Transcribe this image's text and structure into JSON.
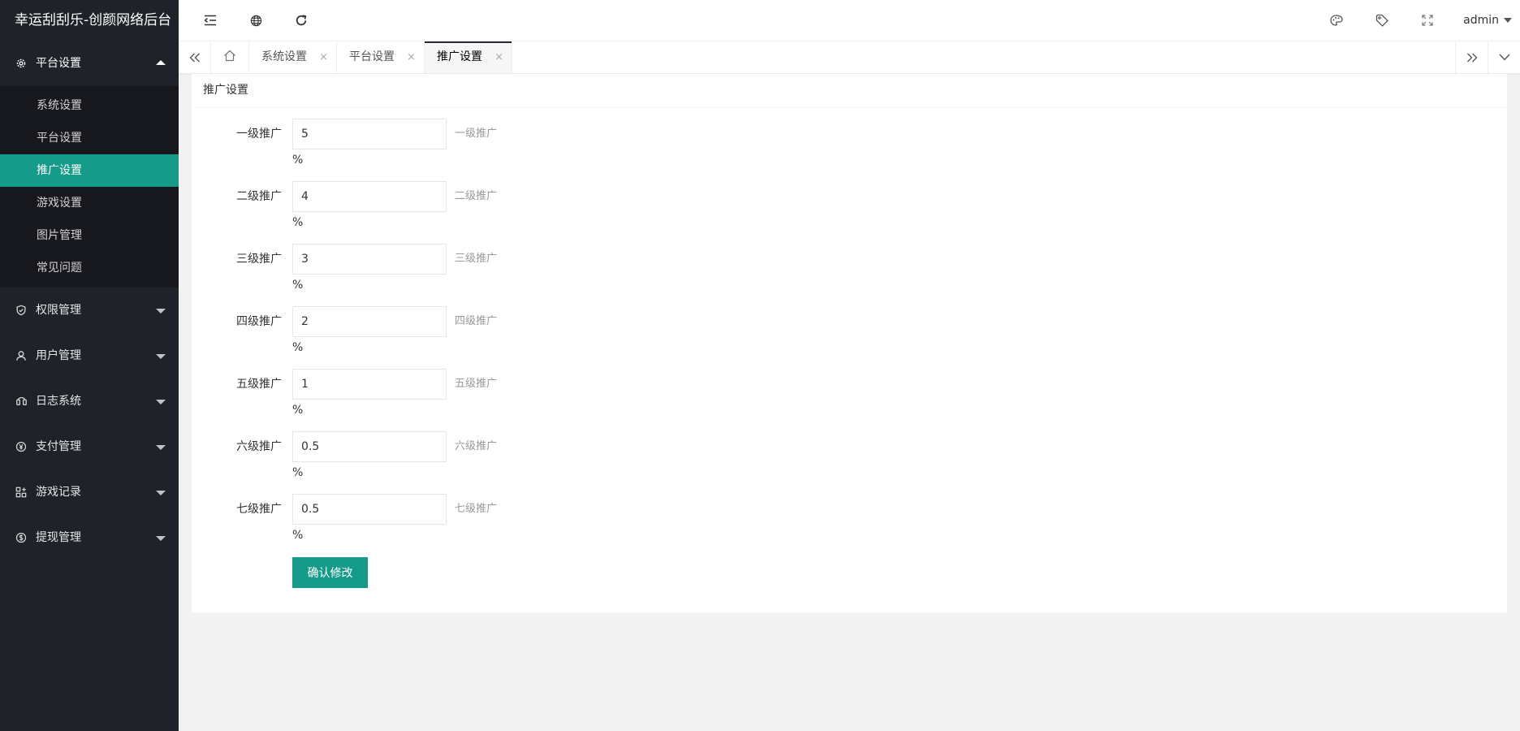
{
  "app": {
    "title": "幸运刮刮乐-创颜网络后台"
  },
  "sidebar": {
    "groups": [
      {
        "label": "平台设置",
        "icon": "gear-icon",
        "open": true,
        "children": [
          "系统设置",
          "平台设置",
          "推广设置",
          "游戏设置",
          "图片管理",
          "常见问题"
        ],
        "active_child": "推广设置"
      },
      {
        "label": "权限管理",
        "icon": "shield-icon"
      },
      {
        "label": "用户管理",
        "icon": "user-icon"
      },
      {
        "label": "日志系统",
        "icon": "log-icon"
      },
      {
        "label": "支付管理",
        "icon": "yen-icon"
      },
      {
        "label": "游戏记录",
        "icon": "apps-icon"
      },
      {
        "label": "提现管理",
        "icon": "dollar-icon"
      }
    ]
  },
  "header": {
    "icons": [
      "menu-fold-icon",
      "globe-icon",
      "refresh-icon",
      "theme-icon",
      "tag-icon",
      "fullscreen-icon"
    ],
    "user": "admin"
  },
  "tabs": {
    "items": [
      {
        "label": "系统设置",
        "close": "×"
      },
      {
        "label": "平台设置",
        "close": "×"
      },
      {
        "label": "推广设置",
        "close": "×",
        "active": true
      }
    ]
  },
  "card": {
    "title": "推广设置",
    "fields": [
      {
        "label": "一级推广",
        "value": "5",
        "hint": "一级推广",
        "unit": "%"
      },
      {
        "label": "二级推广",
        "value": "4",
        "hint": "二级推广",
        "unit": "%"
      },
      {
        "label": "三级推广",
        "value": "3",
        "hint": "三级推广",
        "unit": "%"
      },
      {
        "label": "四级推广",
        "value": "2",
        "hint": "四级推广",
        "unit": "%"
      },
      {
        "label": "五级推广",
        "value": "1",
        "hint": "五级推广",
        "unit": "%"
      },
      {
        "label": "六级推广",
        "value": "0.5",
        "hint": "六级推广",
        "unit": "%"
      },
      {
        "label": "七级推广",
        "value": "0.5",
        "hint": "七级推广",
        "unit": "%"
      }
    ],
    "submit_label": "确认修改"
  },
  "colors": {
    "sidebar_bg": "#20222a",
    "submenu_bg": "#17181e",
    "accent": "#169a8a"
  }
}
